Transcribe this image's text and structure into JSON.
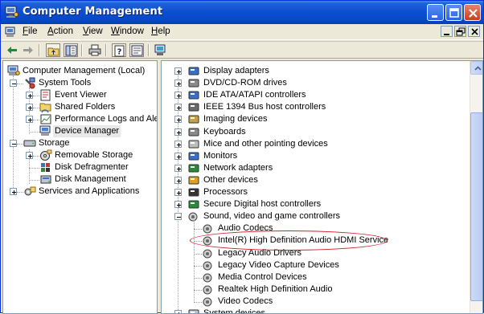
{
  "window": {
    "title": "Computer Management"
  },
  "menubar": {
    "items": [
      "File",
      "Action",
      "View",
      "Window",
      "Help"
    ]
  },
  "toolbar": {
    "buttons": [
      "back-icon",
      "forward-icon",
      "up-folder-icon",
      "show-hide-tree-icon",
      "print-icon",
      "help-icon",
      "properties-icon",
      "device-scan-icon"
    ]
  },
  "left_tree": {
    "root": "Computer Management (Local)",
    "system_tools": "System Tools",
    "event_viewer": "Event Viewer",
    "shared_folders": "Shared Folders",
    "perf_logs": "Performance Logs and Alerts",
    "device_manager": "Device Manager",
    "storage": "Storage",
    "removable_storage": "Removable Storage",
    "disk_defragmenter": "Disk Defragmenter",
    "disk_management": "Disk Management",
    "services_apps": "Services and Applications"
  },
  "device_tree": {
    "categories": [
      "Display adapters",
      "DVD/CD-ROM drives",
      "IDE ATA/ATAPI controllers",
      "IEEE 1394 Bus host controllers",
      "Imaging devices",
      "Keyboards",
      "Mice and other pointing devices",
      "Monitors",
      "Network adapters",
      "Other devices",
      "Processors",
      "Secure Digital host controllers",
      "Sound, video and game controllers"
    ],
    "sound_children": [
      "Audio Codecs",
      "Intel(R) High Definition Audio HDMI Service",
      "Legacy Audio Drivers",
      "Legacy Video Capture Devices",
      "Media Control Devices",
      "Realtek High Definition Audio",
      "Video Codecs"
    ],
    "partial_last": "System devices"
  },
  "colors": {
    "titlebar": "#0a4fd1",
    "highlight_ellipse": "#d21f2a",
    "selection": "#e8e8e8"
  }
}
